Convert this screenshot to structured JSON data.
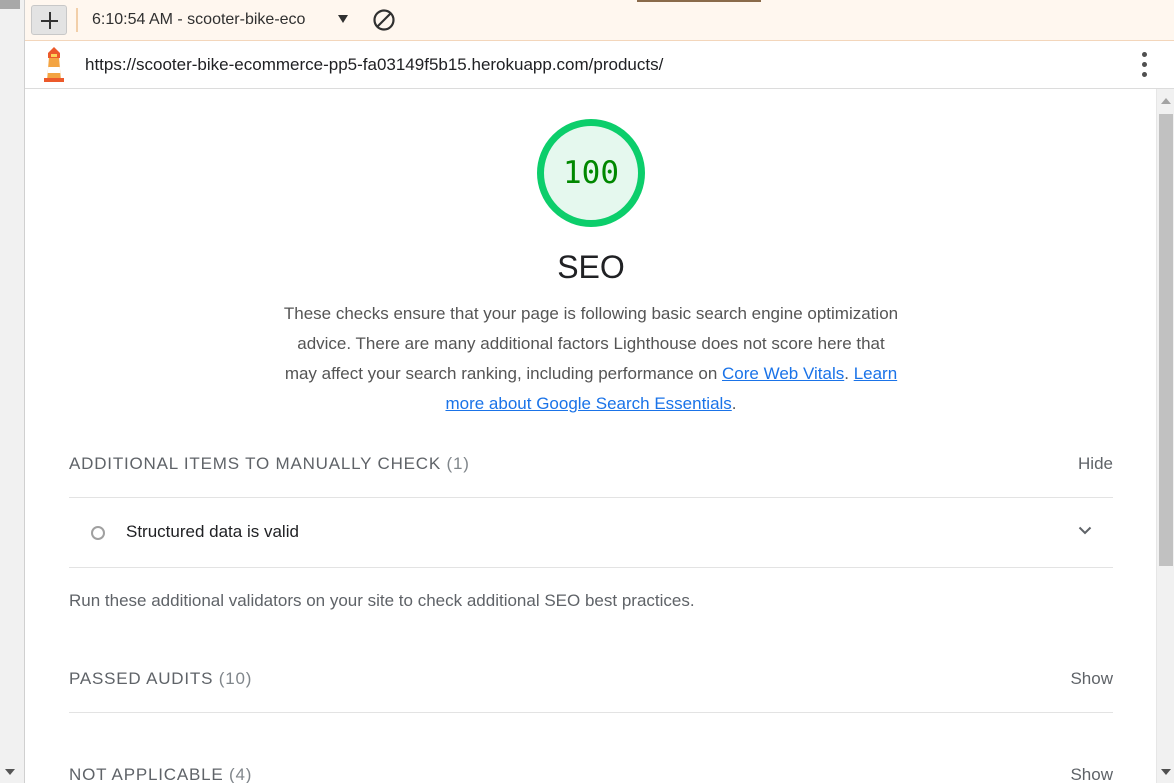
{
  "toolbar": {
    "report_title": "6:10:54 AM - scooter-bike-eco",
    "new_report_label": "+",
    "icons": [
      "plus-icon",
      "caret-down-icon",
      "block-icon"
    ]
  },
  "urlbar": {
    "url": "https://scooter-bike-ecommerce-pp5-fa03149f5b15.herokuapp.com/products/",
    "icons": [
      "lighthouse-logo-icon",
      "kebab-menu-icon"
    ]
  },
  "category": {
    "score": "100",
    "title": "SEO",
    "description": "These checks ensure that your page is following basic search engine optimization advice. There are many additional factors Lighthouse does not score here that may affect your search ranking, including performance on ",
    "link_cwv": "Core Web Vitals",
    "link_sep": ". ",
    "link_learn": "Learn more about Google Search Essentials",
    "end": ".",
    "score_color": "#0cce6b"
  },
  "groups": {
    "manual": {
      "title": "ADDITIONAL ITEMS TO MANUALLY CHECK",
      "count": "(1)",
      "toggle": "Hide",
      "audit_title": "Structured data is valid",
      "description": "Run these additional validators on your site to check additional SEO best practices."
    },
    "passed": {
      "title": "PASSED AUDITS",
      "count": "(10)",
      "toggle": "Show"
    },
    "notapplicable": {
      "title": "NOT APPLICABLE",
      "count": "(4)",
      "toggle": "Show"
    }
  }
}
